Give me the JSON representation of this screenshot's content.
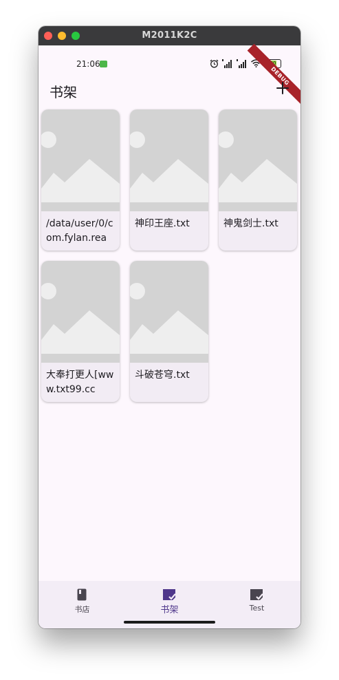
{
  "window": {
    "title": "M2011K2C"
  },
  "status": {
    "time": "21:06",
    "battery": "80",
    "debug_banner": "DEBUG"
  },
  "appbar": {
    "title": "书架",
    "add_icon": "plus-icon"
  },
  "books": [
    {
      "name": "/data/user/0/com.fylan.rea"
    },
    {
      "name": "神印王座.txt"
    },
    {
      "name": "神鬼剑士.txt"
    },
    {
      "name": "大奉打更人[www.txt99.cc"
    },
    {
      "name": "斗破苍穹.txt"
    }
  ],
  "nav": {
    "items": [
      {
        "label": "书店",
        "icon": "book-icon",
        "active": false
      },
      {
        "label": "书架",
        "icon": "bookshelf-check-icon",
        "active": true
      },
      {
        "label": "Test",
        "icon": "bookshelf-check-icon",
        "active": false
      }
    ]
  },
  "colors": {
    "accent": "#4f378b",
    "background": "#fdf7fd",
    "card": "#f2ecf4",
    "placeholder": "#d3d3d3"
  }
}
